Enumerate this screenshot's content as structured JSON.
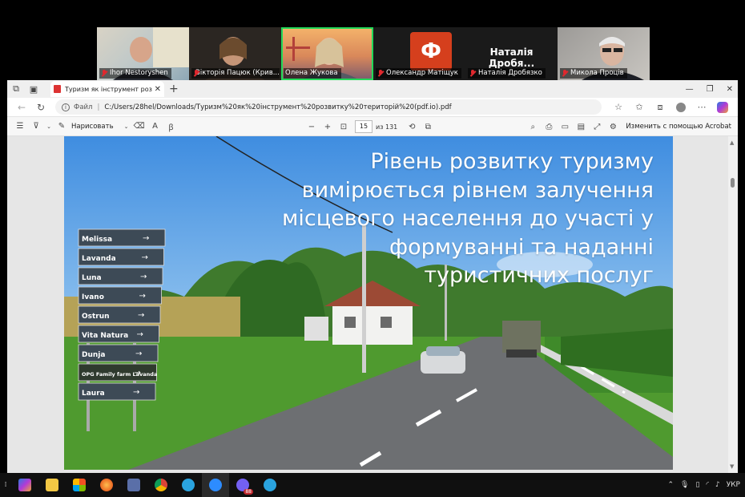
{
  "participants": [
    {
      "name": "Ihor Nestoryshen",
      "muted": true,
      "active": false
    },
    {
      "name": "Вікторія Пацюк (Крив...",
      "muted": true,
      "active": false
    },
    {
      "name": "Олена Жукова",
      "muted": false,
      "active": true
    },
    {
      "name": "Олександр Матіщук",
      "muted": true,
      "active": false,
      "avatar_letter": "Ф"
    },
    {
      "name": "Наталія Дробязко",
      "muted": true,
      "active": false,
      "display_title": "Наталія Дробя..."
    },
    {
      "name": "Микола Проців",
      "muted": true,
      "active": false
    }
  ],
  "browser": {
    "tab_title": "Туризм як інструмент розвитку",
    "url_label": "Файл",
    "url": "C:/Users/28hel/Downloads/Туризм%20як%20інструмент%20розвитку%20територій%20(pdf.io).pdf"
  },
  "pdf_toolbar": {
    "draw_label": "Нарисовать",
    "page_current": "15",
    "page_total": "из 131",
    "edit_acrobat_label": "Изменить с помощью Acrobat"
  },
  "slide": {
    "text_lines": [
      "Рівень розвитку туризму",
      "вимірюється рівнем залучення",
      "місцевого населення до участі у",
      "формуванні та наданні",
      "туристичних послуг"
    ],
    "sign_entries": [
      "Melissa",
      "Lavanda",
      "Luna",
      "Ivano",
      "Ostrun",
      "Vita Natura",
      "Dunja",
      "OPG Family farm Lavanda",
      "Laura"
    ]
  },
  "taskbar": {
    "viber_badge": "88",
    "language": "УКР"
  },
  "colors": {
    "active_speaker": "#23d959",
    "avatar_bg": "#d53f1d",
    "muted": "#e0282e"
  }
}
